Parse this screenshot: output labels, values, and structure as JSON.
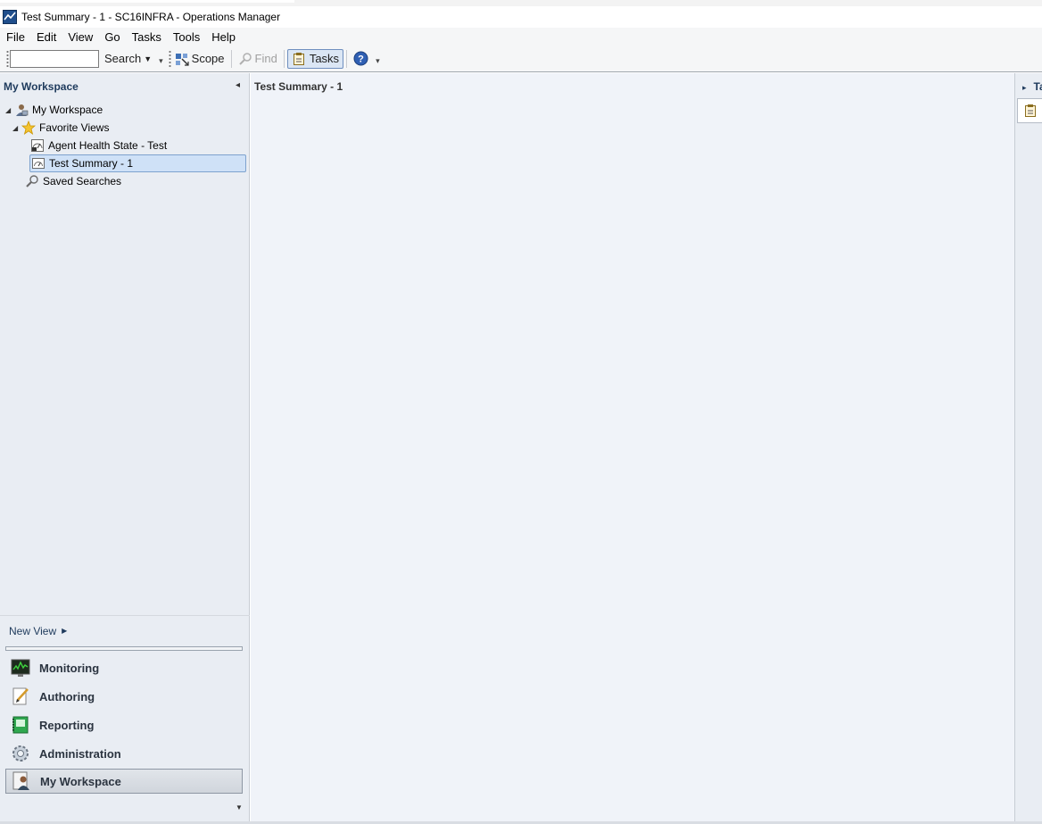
{
  "window": {
    "title": "Test Summary - 1 - SC16INFRA - Operations Manager"
  },
  "menu": [
    "File",
    "Edit",
    "View",
    "Go",
    "Tasks",
    "Tools",
    "Help"
  ],
  "toolbar": {
    "search_value": "",
    "search_label": "Search",
    "scope_label": "Scope",
    "find_label": "Find",
    "tasks_label": "Tasks"
  },
  "left_pane": {
    "header": "My Workspace",
    "tree": [
      {
        "label": "My Workspace",
        "icon": "workspace-icon"
      },
      {
        "label": "Favorite Views",
        "icon": "star-icon"
      },
      {
        "label": "Agent Health State - Test",
        "icon": "state-view-icon"
      },
      {
        "label": "Test Summary - 1",
        "icon": "dashboard-view-icon",
        "selected": true
      },
      {
        "label": "Saved Searches",
        "icon": "magnifier-icon"
      }
    ],
    "new_view_label": "New View",
    "wunderbar": [
      {
        "label": "Monitoring",
        "icon": "monitoring-icon"
      },
      {
        "label": "Authoring",
        "icon": "authoring-icon"
      },
      {
        "label": "Reporting",
        "icon": "reporting-icon"
      },
      {
        "label": "Administration",
        "icon": "administration-icon"
      },
      {
        "label": "My Workspace",
        "icon": "my-workspace-icon",
        "selected": true
      }
    ]
  },
  "main": {
    "title": "Test Summary - 1"
  },
  "right_pane": {
    "header": "Ta"
  },
  "colors": {
    "pane_bg": "#e9edf3",
    "main_bg": "#f0f3f9",
    "header_text": "#1e3a5c",
    "selection_bg": "#cfe1f7"
  }
}
